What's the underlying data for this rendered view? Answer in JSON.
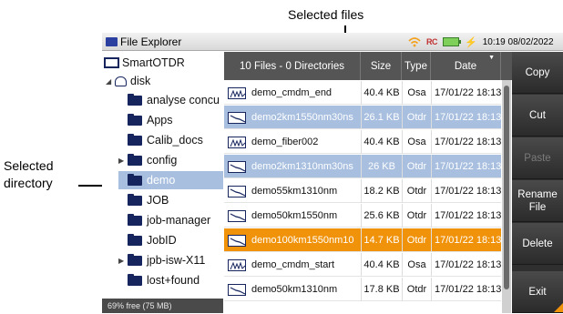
{
  "callouts": {
    "files": "Selected files",
    "dir_line1": "Selected",
    "dir_line2": "directory"
  },
  "titlebar": {
    "title": "File Explorer",
    "rc": "RC",
    "clock": "10:19 08/02/2022"
  },
  "tree": {
    "root": "SmartOTDR",
    "disk": "disk",
    "items": [
      {
        "label": "analyse concu",
        "expandable": false
      },
      {
        "label": "Apps",
        "expandable": false
      },
      {
        "label": "Calib_docs",
        "expandable": false
      },
      {
        "label": "config",
        "expandable": true
      },
      {
        "label": "demo",
        "expandable": false,
        "selected": true
      },
      {
        "label": "JOB",
        "expandable": false
      },
      {
        "label": "job-manager",
        "expandable": false
      },
      {
        "label": "JobID",
        "expandable": false
      },
      {
        "label": "jpb-isw-X11",
        "expandable": true
      },
      {
        "label": "lost+found",
        "expandable": false
      }
    ],
    "free_space": "69% free (75 MB)"
  },
  "table": {
    "headers": {
      "name": "10 Files - 0 Directories",
      "size": "Size",
      "type": "Type",
      "date": "Date"
    },
    "rows": [
      {
        "icon": "osa-trace-icon",
        "name": "demo_cmdm_end",
        "size": "40.4 KB",
        "type": "Osa",
        "date": "17/01/22 18:13",
        "state": "normal"
      },
      {
        "icon": "otdr-trace-icon",
        "name": "demo2km1550nm30ns",
        "size": "26.1 KB",
        "type": "Otdr",
        "date": "17/01/22 18:13",
        "state": "selected"
      },
      {
        "icon": "osa-trace-icon",
        "name": "demo_fiber002",
        "size": "40.4 KB",
        "type": "Osa",
        "date": "17/01/22 18:13",
        "state": "normal"
      },
      {
        "icon": "otdr-trace-icon",
        "name": "demo2km1310nm30ns",
        "size": "26 KB",
        "type": "Otdr",
        "date": "17/01/22 18:13",
        "state": "selected"
      },
      {
        "icon": "otdr-trace-icon",
        "name": "demo55km1310nm",
        "size": "18.2 KB",
        "type": "Otdr",
        "date": "17/01/22 18:13",
        "state": "normal"
      },
      {
        "icon": "otdr-trace-icon",
        "name": "demo50km1550nm",
        "size": "25.6 KB",
        "type": "Otdr",
        "date": "17/01/22 18:13",
        "state": "normal"
      },
      {
        "icon": "otdr-trace-icon",
        "name": "demo100km1550nm10",
        "size": "14.7 KB",
        "type": "Otdr",
        "date": "17/01/22 18:13",
        "state": "current"
      },
      {
        "icon": "osa-trace-icon",
        "name": "demo_cmdm_start",
        "size": "40.4 KB",
        "type": "Osa",
        "date": "17/01/22 18:13",
        "state": "normal"
      },
      {
        "icon": "otdr-trace-icon",
        "name": "demo50km1310nm",
        "size": "17.8 KB",
        "type": "Otdr",
        "date": "17/01/22 18:13",
        "state": "normal"
      }
    ]
  },
  "buttons": {
    "copy": "Copy",
    "cut": "Cut",
    "paste": "Paste",
    "rename_1": "Rename",
    "rename_2": "File",
    "delete": "Delete",
    "exit": "Exit"
  },
  "colors": {
    "selection_blue": "#a8bfe0",
    "current_orange": "#f0920a",
    "header_gray": "#555555",
    "sidebar_dark": "#2f2f2f"
  }
}
